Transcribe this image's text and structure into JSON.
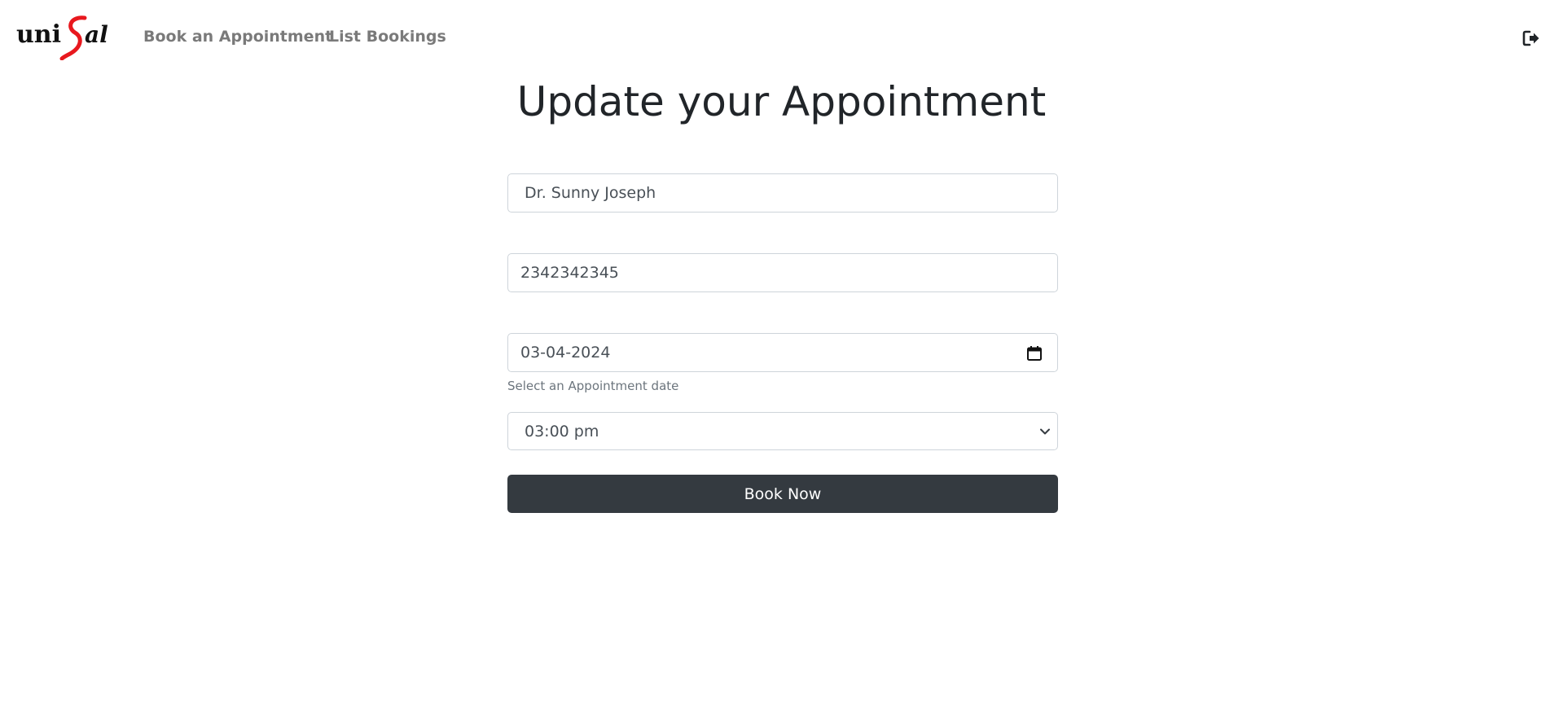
{
  "nav": {
    "logo_text": "uniSal",
    "links": [
      {
        "label": "Book an Appointment"
      },
      {
        "label": "List Bookings"
      }
    ],
    "logout_icon": "sign-out-icon"
  },
  "page": {
    "title": "Update your Appointment"
  },
  "form": {
    "doctor_value": "Dr. Sunny Joseph",
    "phone_value": "2342342345",
    "date_value": "03-04-2024",
    "date_help": "Select an Appointment date",
    "time_value": "03:00 pm",
    "submit_label": "Book Now"
  },
  "colors": {
    "logo_accent": "#e8181e",
    "button_bg": "#343a40",
    "nav_link": "#7a7a7a"
  }
}
